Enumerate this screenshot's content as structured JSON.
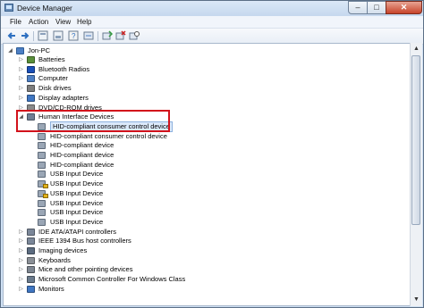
{
  "window": {
    "title": "Device Manager",
    "minimize": "–",
    "maximize": "□",
    "close": "✕"
  },
  "menu": [
    "File",
    "Action",
    "View",
    "Help"
  ],
  "toolbar": [
    "back-icon",
    "forward-icon",
    "properties-icon",
    "show-hide-icon",
    "help-icon",
    "scan-icon",
    "update-driver-icon",
    "uninstall-icon",
    "disable-icon"
  ],
  "tree": {
    "root": "Jon-PC",
    "categories": [
      {
        "label": "Batteries",
        "icon": "battery-icon",
        "color": "#5a8f3a"
      },
      {
        "label": "Bluetooth Radios",
        "icon": "bluetooth-icon",
        "color": "#1a4fb8"
      },
      {
        "label": "Computer",
        "icon": "computer-icon",
        "color": "#4d7fc4"
      },
      {
        "label": "Disk drives",
        "icon": "disk-icon",
        "color": "#7d7d7d"
      },
      {
        "label": "Display adapters",
        "icon": "display-icon",
        "color": "#3f76c2"
      },
      {
        "label": "DVD/CD-ROM drives",
        "icon": "dvd-icon",
        "color": "#8a8a8a"
      },
      {
        "label": "Human Interface Devices",
        "icon": "hid-icon",
        "color": "#6f7f95",
        "expanded": true,
        "children": [
          {
            "label": "HID-compliant consumer control device",
            "selected": true
          },
          {
            "label": "HID-compliant consumer control device"
          },
          {
            "label": "HID-compliant device"
          },
          {
            "label": "HID-compliant device"
          },
          {
            "label": "HID-compliant device"
          },
          {
            "label": "USB Input Device"
          },
          {
            "label": "USB Input Device",
            "warning": true
          },
          {
            "label": "USB Input Device",
            "warning": true
          },
          {
            "label": "USB Input Device"
          },
          {
            "label": "USB Input Device"
          },
          {
            "label": "USB Input Device"
          }
        ]
      },
      {
        "label": "IDE ATA/ATAPI controllers",
        "icon": "ide-icon",
        "color": "#7b8799"
      },
      {
        "label": "IEEE 1394 Bus host controllers",
        "icon": "ieee1394-icon",
        "color": "#7b8799"
      },
      {
        "label": "Imaging devices",
        "icon": "camera-icon",
        "color": "#5c6c80"
      },
      {
        "label": "Keyboards",
        "icon": "keyboard-icon",
        "color": "#8a8f96"
      },
      {
        "label": "Mice and other pointing devices",
        "icon": "mouse-icon",
        "color": "#7d8590"
      },
      {
        "label": "Microsoft Common Controller For Windows Class",
        "icon": "controller-icon",
        "color": "#6a7a8c"
      },
      {
        "label": "Monitors",
        "icon": "monitor-icon",
        "color": "#3f76c2"
      }
    ]
  },
  "colors": {
    "warning": "#e3b21a",
    "highlight": "#d2121b",
    "selection": "#dbe9fa"
  }
}
